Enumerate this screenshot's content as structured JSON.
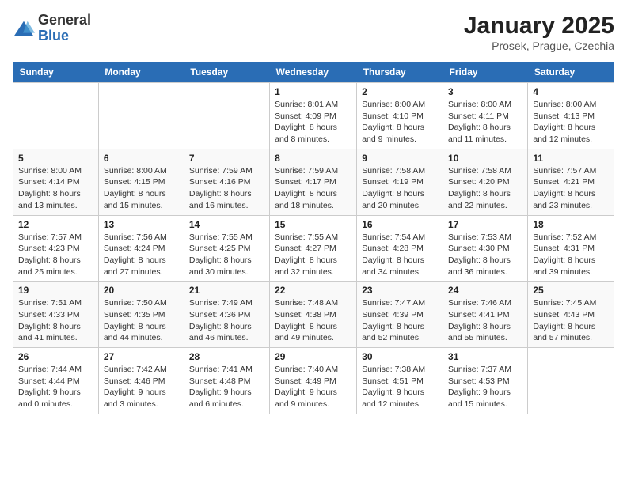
{
  "header": {
    "logo_general": "General",
    "logo_blue": "Blue",
    "title": "January 2025",
    "subtitle": "Prosek, Prague, Czechia"
  },
  "weekdays": [
    "Sunday",
    "Monday",
    "Tuesday",
    "Wednesday",
    "Thursday",
    "Friday",
    "Saturday"
  ],
  "weeks": [
    [
      {
        "day": "",
        "info": ""
      },
      {
        "day": "",
        "info": ""
      },
      {
        "day": "",
        "info": ""
      },
      {
        "day": "1",
        "info": "Sunrise: 8:01 AM\nSunset: 4:09 PM\nDaylight: 8 hours and 8 minutes."
      },
      {
        "day": "2",
        "info": "Sunrise: 8:00 AM\nSunset: 4:10 PM\nDaylight: 8 hours and 9 minutes."
      },
      {
        "day": "3",
        "info": "Sunrise: 8:00 AM\nSunset: 4:11 PM\nDaylight: 8 hours and 11 minutes."
      },
      {
        "day": "4",
        "info": "Sunrise: 8:00 AM\nSunset: 4:13 PM\nDaylight: 8 hours and 12 minutes."
      }
    ],
    [
      {
        "day": "5",
        "info": "Sunrise: 8:00 AM\nSunset: 4:14 PM\nDaylight: 8 hours and 13 minutes."
      },
      {
        "day": "6",
        "info": "Sunrise: 8:00 AM\nSunset: 4:15 PM\nDaylight: 8 hours and 15 minutes."
      },
      {
        "day": "7",
        "info": "Sunrise: 7:59 AM\nSunset: 4:16 PM\nDaylight: 8 hours and 16 minutes."
      },
      {
        "day": "8",
        "info": "Sunrise: 7:59 AM\nSunset: 4:17 PM\nDaylight: 8 hours and 18 minutes."
      },
      {
        "day": "9",
        "info": "Sunrise: 7:58 AM\nSunset: 4:19 PM\nDaylight: 8 hours and 20 minutes."
      },
      {
        "day": "10",
        "info": "Sunrise: 7:58 AM\nSunset: 4:20 PM\nDaylight: 8 hours and 22 minutes."
      },
      {
        "day": "11",
        "info": "Sunrise: 7:57 AM\nSunset: 4:21 PM\nDaylight: 8 hours and 23 minutes."
      }
    ],
    [
      {
        "day": "12",
        "info": "Sunrise: 7:57 AM\nSunset: 4:23 PM\nDaylight: 8 hours and 25 minutes."
      },
      {
        "day": "13",
        "info": "Sunrise: 7:56 AM\nSunset: 4:24 PM\nDaylight: 8 hours and 27 minutes."
      },
      {
        "day": "14",
        "info": "Sunrise: 7:55 AM\nSunset: 4:25 PM\nDaylight: 8 hours and 30 minutes."
      },
      {
        "day": "15",
        "info": "Sunrise: 7:55 AM\nSunset: 4:27 PM\nDaylight: 8 hours and 32 minutes."
      },
      {
        "day": "16",
        "info": "Sunrise: 7:54 AM\nSunset: 4:28 PM\nDaylight: 8 hours and 34 minutes."
      },
      {
        "day": "17",
        "info": "Sunrise: 7:53 AM\nSunset: 4:30 PM\nDaylight: 8 hours and 36 minutes."
      },
      {
        "day": "18",
        "info": "Sunrise: 7:52 AM\nSunset: 4:31 PM\nDaylight: 8 hours and 39 minutes."
      }
    ],
    [
      {
        "day": "19",
        "info": "Sunrise: 7:51 AM\nSunset: 4:33 PM\nDaylight: 8 hours and 41 minutes."
      },
      {
        "day": "20",
        "info": "Sunrise: 7:50 AM\nSunset: 4:35 PM\nDaylight: 8 hours and 44 minutes."
      },
      {
        "day": "21",
        "info": "Sunrise: 7:49 AM\nSunset: 4:36 PM\nDaylight: 8 hours and 46 minutes."
      },
      {
        "day": "22",
        "info": "Sunrise: 7:48 AM\nSunset: 4:38 PM\nDaylight: 8 hours and 49 minutes."
      },
      {
        "day": "23",
        "info": "Sunrise: 7:47 AM\nSunset: 4:39 PM\nDaylight: 8 hours and 52 minutes."
      },
      {
        "day": "24",
        "info": "Sunrise: 7:46 AM\nSunset: 4:41 PM\nDaylight: 8 hours and 55 minutes."
      },
      {
        "day": "25",
        "info": "Sunrise: 7:45 AM\nSunset: 4:43 PM\nDaylight: 8 hours and 57 minutes."
      }
    ],
    [
      {
        "day": "26",
        "info": "Sunrise: 7:44 AM\nSunset: 4:44 PM\nDaylight: 9 hours and 0 minutes."
      },
      {
        "day": "27",
        "info": "Sunrise: 7:42 AM\nSunset: 4:46 PM\nDaylight: 9 hours and 3 minutes."
      },
      {
        "day": "28",
        "info": "Sunrise: 7:41 AM\nSunset: 4:48 PM\nDaylight: 9 hours and 6 minutes."
      },
      {
        "day": "29",
        "info": "Sunrise: 7:40 AM\nSunset: 4:49 PM\nDaylight: 9 hours and 9 minutes."
      },
      {
        "day": "30",
        "info": "Sunrise: 7:38 AM\nSunset: 4:51 PM\nDaylight: 9 hours and 12 minutes."
      },
      {
        "day": "31",
        "info": "Sunrise: 7:37 AM\nSunset: 4:53 PM\nDaylight: 9 hours and 15 minutes."
      },
      {
        "day": "",
        "info": ""
      }
    ]
  ]
}
